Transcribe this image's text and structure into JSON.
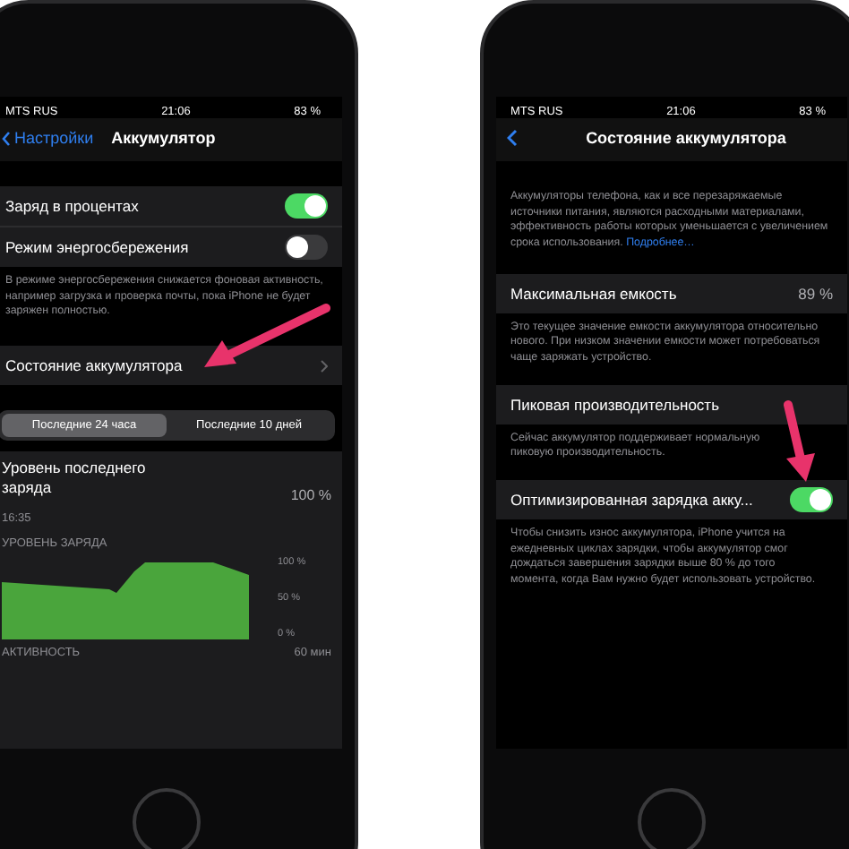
{
  "left_phone": {
    "status_bar": {
      "carrier": "MTS RUS",
      "time": "21:06",
      "battery": "83 %"
    },
    "nav": {
      "back": "Настройки",
      "title": "Аккумулятор"
    },
    "settings": [
      {
        "kind": "toggle",
        "label": "Заряд в процентах",
        "on": true
      },
      {
        "kind": "toggle",
        "label": "Режим энергосбережения",
        "on": false
      }
    ],
    "note": "В режиме энергосбережения снижается фоновая активность, например загрузка и проверка почты, пока iPhone не будет заряжен полностью.",
    "health_row": {
      "label": "Состояние аккумулятора"
    },
    "tabs": [
      {
        "label": "Последние 24 часа",
        "selected": true
      },
      {
        "label": "Последние 10 дней",
        "selected": false
      }
    ],
    "last_charge": {
      "label": "Уровень последнего заряда",
      "time": "16:35",
      "value": "100 %"
    },
    "chart": {
      "title": "УРОВЕНЬ ЗАРЯДА",
      "axis_labels": [
        "100 %",
        "50 %",
        "0 %"
      ]
    },
    "activity": {
      "title": "АКТИВНОСТЬ",
      "axis_label": "60 мин"
    }
  },
  "right_phone": {
    "status_bar": {
      "carrier": "MTS RUS",
      "time": "21:06",
      "battery": "83 %"
    },
    "nav": {
      "title": "Состояние аккумулятора"
    },
    "intro": "Аккумуляторы телефона, как и все перезаряжаемые источники питания, являются расходными материалами, эффективность работы которых уменьшается с увеличением срока использования.",
    "intro_link": "Подробнее…",
    "sections": [
      {
        "kind": "value",
        "label": "Максимальная емкость",
        "value": "89 %",
        "note": "Это текущее значение емкости аккумулятора относительно нового. При низком значении емкости может потребоваться чаще заряжать устройство."
      },
      {
        "kind": "plain",
        "label": "Пиковая производительность",
        "note": "Сейчас аккумулятор поддерживает нормальную пиковую производительность."
      },
      {
        "kind": "toggle",
        "label": "Оптимизированная зарядка акку...",
        "on": true,
        "note": "Чтобы снизить износ аккумулятора, iPhone учится на ежедневных циклах зарядки, чтобы аккумулятор смог дождаться завершения зарядки выше 80 % до того момента, когда Вам нужно будет использовать устройство."
      }
    ]
  }
}
